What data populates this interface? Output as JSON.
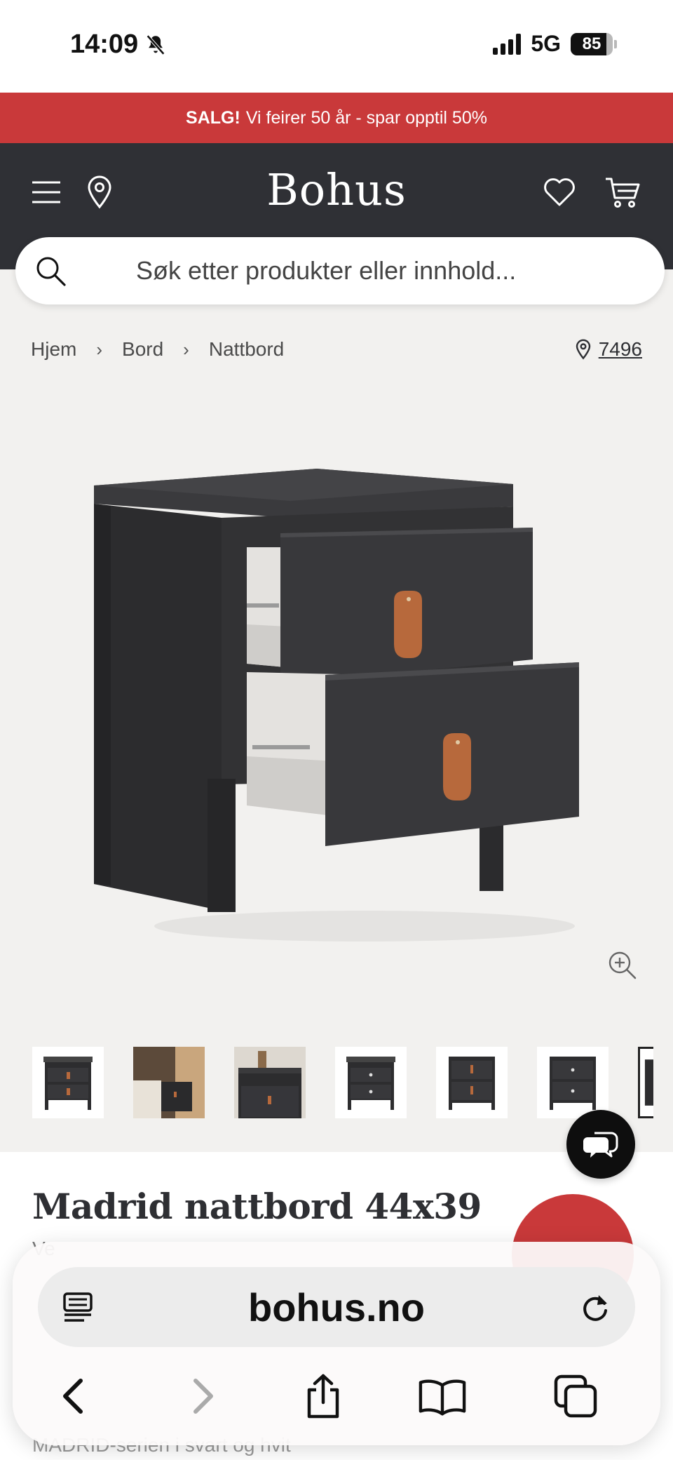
{
  "status_bar": {
    "time": "14:09",
    "network": "5G",
    "battery": "85",
    "battery_level": 0.85
  },
  "sale_banner": {
    "highlight": "SALG!",
    "text": "Vi feirer 50 år - spar opptil 50%"
  },
  "header": {
    "logo": "Bohus",
    "icons": [
      "menu-icon",
      "location-pin-icon",
      "heart-icon",
      "cart-icon"
    ]
  },
  "search": {
    "placeholder": "Søk etter produkter eller innhold..."
  },
  "breadcrumb": {
    "items": [
      "Hjem",
      "Bord",
      "Nattbord"
    ],
    "store_number": "7496"
  },
  "product": {
    "title": "Madrid nattbord 44x39",
    "subtitle_partial": "Ve",
    "description_partial": "MADRID-serien i svart og hvit",
    "thumbnail_count": 7
  },
  "safari": {
    "url": "bohus.no",
    "icons": [
      "reader-icon",
      "reload-icon",
      "back-icon",
      "forward-icon",
      "share-icon",
      "bookmarks-icon",
      "tabs-icon"
    ]
  },
  "colors": {
    "accent_red": "#c9393a",
    "header_dark": "#2f3035",
    "product_black": "#2b2b2d",
    "leather": "#b7693c"
  }
}
